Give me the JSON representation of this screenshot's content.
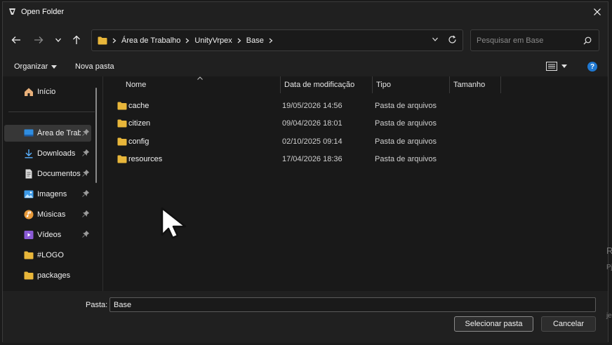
{
  "window": {
    "title": "Open Folder"
  },
  "address": {
    "breadcrumbs": [
      "Área de Trabalho",
      "UnityVrpex",
      "Base"
    ]
  },
  "search": {
    "placeholder": "Pesquisar em Base"
  },
  "toolbar": {
    "organize_label": "Organizar",
    "new_folder_label": "Nova pasta",
    "help_label": "?"
  },
  "sidebar": {
    "items": [
      {
        "label": "Início",
        "icon": "home-icon",
        "pinned": false,
        "selected": false
      },
      {
        "label": "Área de Trab",
        "icon": "desktop-icon",
        "pinned": true,
        "selected": true
      },
      {
        "label": "Downloads",
        "icon": "download-icon",
        "pinned": true,
        "selected": false
      },
      {
        "label": "Documentos",
        "icon": "document-icon",
        "pinned": true,
        "selected": false
      },
      {
        "label": "Imagens",
        "icon": "image-icon",
        "pinned": true,
        "selected": false
      },
      {
        "label": "Músicas",
        "icon": "music-icon",
        "pinned": true,
        "selected": false
      },
      {
        "label": "Vídeos",
        "icon": "video-icon",
        "pinned": true,
        "selected": false
      },
      {
        "label": "#LOGO",
        "icon": "folder-icon",
        "pinned": false,
        "selected": false
      },
      {
        "label": "packages",
        "icon": "folder-icon",
        "pinned": false,
        "selected": false
      }
    ]
  },
  "columns": {
    "name": "Nome",
    "date": "Data de modificação",
    "type": "Tipo",
    "size": "Tamanho"
  },
  "files": [
    {
      "name": "cache",
      "date": "19/05/2026 14:56",
      "type": "Pasta de arquivos"
    },
    {
      "name": "citizen",
      "date": "09/04/2026 18:01",
      "type": "Pasta de arquivos"
    },
    {
      "name": "config",
      "date": "02/10/2025 09:14",
      "type": "Pasta de arquivos"
    },
    {
      "name": "resources",
      "date": "17/04/2026 18:36",
      "type": "Pasta de arquivos"
    }
  ],
  "footer": {
    "folder_label": "Pasta:",
    "folder_value": "Base",
    "select_button": "Selecionar pasta",
    "cancel_button": "Cancelar"
  },
  "background_fragments": [
    "R",
    "Pj",
    "je"
  ],
  "colors": {
    "folder": "#e8b63a",
    "accent": "#1f78d1",
    "selected": "#373737"
  }
}
